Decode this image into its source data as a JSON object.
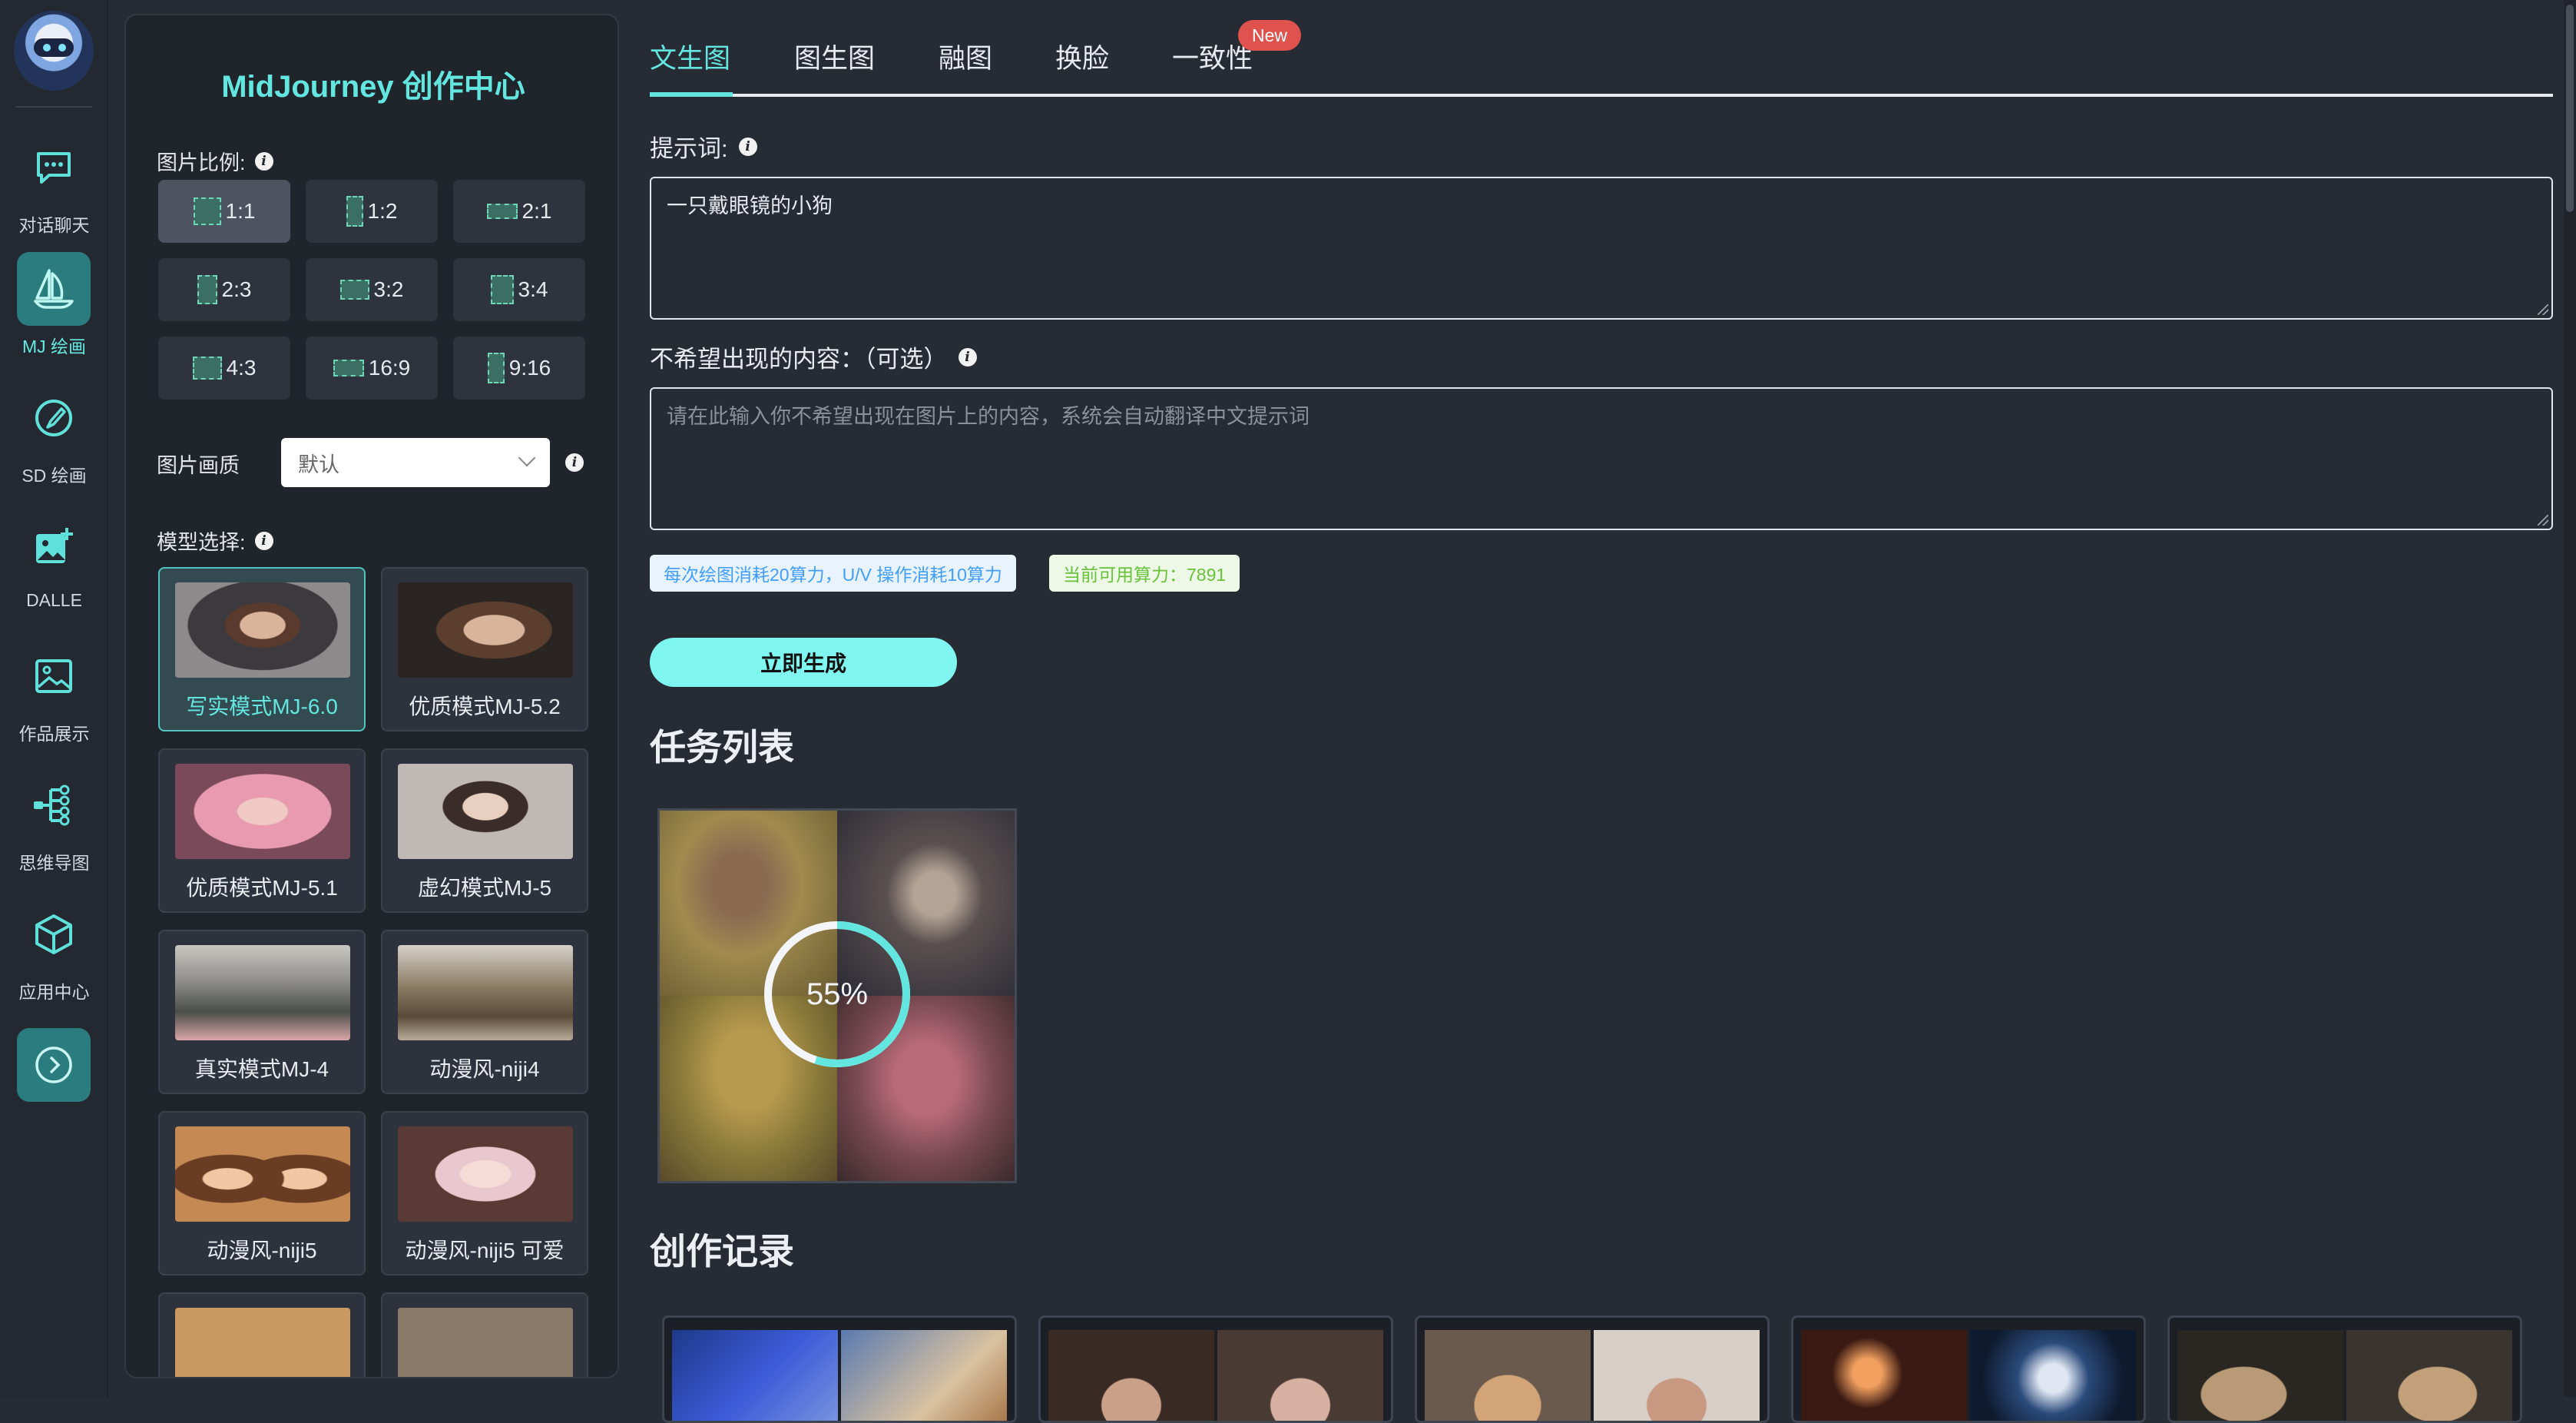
{
  "nav": {
    "items": [
      {
        "label": "对话聊天",
        "icon": "chat-icon",
        "active": false
      },
      {
        "label": "MJ 绘画",
        "icon": "sailboat-icon",
        "active": true
      },
      {
        "label": "SD 绘画",
        "icon": "brush-icon",
        "active": false
      },
      {
        "label": "DALLE",
        "icon": "image-plus-icon",
        "active": false
      },
      {
        "label": "作品展示",
        "icon": "picture-icon",
        "active": false
      },
      {
        "label": "思维导图",
        "icon": "mindmap-icon",
        "active": false
      },
      {
        "label": "应用中心",
        "icon": "cube-icon",
        "active": false
      }
    ],
    "expand_icon": "chevron-right-circle-icon"
  },
  "panel": {
    "title": "MidJourney 创作中心",
    "ratio_label": "图片比例:",
    "ratios": [
      "1:1",
      "1:2",
      "2:1",
      "2:3",
      "3:2",
      "3:4",
      "4:3",
      "16:9",
      "9:16"
    ],
    "selected_ratio": "1:1",
    "quality_label": "图片画质",
    "quality_value": "默认",
    "model_label": "模型选择:",
    "models": [
      {
        "label": "写实模式MJ-6.0",
        "active": true
      },
      {
        "label": "优质模式MJ-5.2",
        "active": false
      },
      {
        "label": "优质模式MJ-5.1",
        "active": false
      },
      {
        "label": "虚幻模式MJ-5",
        "active": false
      },
      {
        "label": "真实模式MJ-4",
        "active": false
      },
      {
        "label": "动漫风-niji4",
        "active": false
      },
      {
        "label": "动漫风-niji5",
        "active": false
      },
      {
        "label": "动漫风-niji5 可爱",
        "active": false
      }
    ]
  },
  "tabs": [
    {
      "label": "文生图",
      "active": true
    },
    {
      "label": "图生图",
      "active": false
    },
    {
      "label": "融图",
      "active": false
    },
    {
      "label": "换脸",
      "active": false
    },
    {
      "label": "一致性",
      "active": false
    }
  ],
  "new_badge": "New",
  "prompt": {
    "label": "提示词:",
    "value": "一只戴眼镜的小狗"
  },
  "negative": {
    "label": "不希望出现的内容：（可选）",
    "placeholder": "请在此输入你不希望出现在图片上的内容，系统会自动翻译中文提示词"
  },
  "tags": {
    "cost": "每次绘图消耗20算力，U/V 操作消耗10算力",
    "balance": "当前可用算力：7891"
  },
  "generate_button": "立即生成",
  "task_list": {
    "heading": "任务列表",
    "progress": 0.55,
    "progress_text": "55%"
  },
  "records": {
    "heading": "创作记录"
  },
  "colors": {
    "accent": "#63e6e0",
    "button": "#7ff6ef",
    "background": "#272b34",
    "panel": "#20242b",
    "badge": "#e0524d"
  }
}
